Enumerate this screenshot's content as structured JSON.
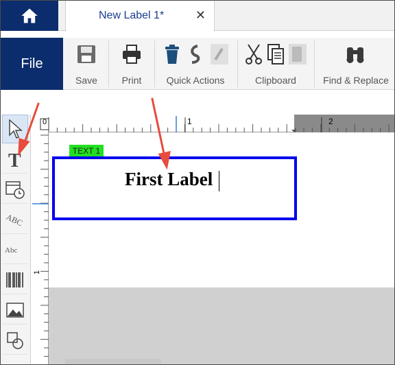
{
  "tab": {
    "title": "New Label 1*",
    "close": "✕"
  },
  "ribbon": {
    "file": "File",
    "groups": {
      "save": "Save",
      "print": "Print",
      "quick_actions": "Quick Actions",
      "clipboard": "Clipboard",
      "find_replace": "Find & Replace"
    }
  },
  "rulers": {
    "h_marks": [
      "0",
      "1",
      "2"
    ],
    "v_marks": [
      "0",
      "1"
    ]
  },
  "canvas": {
    "object_tag": "TEXT 1",
    "text": "First Label",
    "accent": "#0000ee",
    "tag_color": "#22e022"
  },
  "tools": [
    "pointer-icon",
    "text-icon",
    "date-time-icon",
    "curved-text-icon",
    "paragraph-text-icon",
    "barcode-icon",
    "image-icon",
    "shape-icon"
  ]
}
